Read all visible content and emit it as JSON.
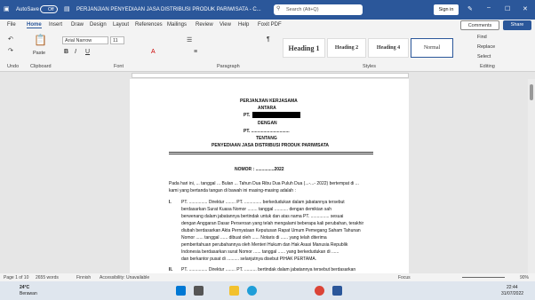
{
  "titlebar": {
    "autosave": "AutoSave",
    "autosave_state": "Off",
    "doc": "PERJANJIAN PENYEDIAAN JASA DISTRIBUSI PRODUK PARIWISATA - C... ",
    "search": "Search (Alt+Q)",
    "signin": "Sign in"
  },
  "tabs": [
    "File",
    "Home",
    "Insert",
    "Draw",
    "Design",
    "Layout",
    "References",
    "Mailings",
    "Review",
    "View",
    "Help",
    "Foxit PDF"
  ],
  "comments": "Comments",
  "share": "Share",
  "ribbon": {
    "font": "Arial Narrow",
    "size": "11",
    "groups": [
      "Undo",
      "Clipboard",
      "Font",
      "Paragraph",
      "Styles",
      "Editing"
    ],
    "paste": "Paste",
    "styles": [
      "Heading 1",
      "Heading 2",
      "Heading 4",
      "Normal"
    ],
    "find": "Find",
    "replace": "Replace",
    "select": "Select"
  },
  "doc": {
    "l1": "PERJANJIAN KERJASAMA",
    "l2": "ANTARA",
    "l3": "PT.",
    "l4": "DENGAN",
    "l5": "PT. ...............................",
    "l6": "TENTANG",
    "l7": "PENYEDIAAN JASA DISTRIBUSI PRODUK PARIWISATA",
    "l8": "NOMOR   :   ...............2022",
    "p1a": "Pada hari ini, ... tanggal ... Bulan ... Tahun Dua Ribu Dua Puluh Dua (...-...- 2022) bertempat di ...",
    "p1b": "kami yang bertanda tangan di bawah ini masing-masing adalah :",
    "i1": "I.",
    "i1a": "PT. ............... Direktur ........ PT. .............. berkedudukan dalam jabatannya tersebut",
    "i1b": "berdasarkan Surat Kuasa Nomor ........ tanggal ........... dengan demikian sah",
    "i1c": "berwenang dalam jabatannya bertindak untuk dan atas nama PT. ............... sesuai",
    "i1d": "dengan Anggaran Dasar Perseroan yang telah mengalami beberapa kali perubahan, terakhir",
    "i1e": "diubah berdasarkan Akta Pernyataan Keputusan Rapat Umum Pemegang Saham Tahunan",
    "i1f": "Nomor ...... tanggal ...... dibuat oleh ...... Notaris di ...... yang telah diterima",
    "i1g": "pemberitahuan perubahannya oleh Menteri Hukum dan Hak Asasi Manusia Republik",
    "i1h": "Indonesia berdasarkan surat Nomor ...... tanggal ...... yang berkedudukan di ......",
    "i1i": "dan berkantor pusat di .......... selanjutnya disebut PIHAK PERTAMA.",
    "i2": "II.",
    "i2a": "PT. ............... Direktur ........ PT. .......... bertindak dalam jabatannya tersebut berdasarkan"
  },
  "status": {
    "page": "Page 1 of 10",
    "words": "2655 words",
    "lang": "Finnish",
    "access": "Accessibility: Unavailable",
    "focus": "Focus",
    "zoom": "90%"
  },
  "taskbar": {
    "temp": "24°C",
    "weather": "Berawan",
    "time": "22:44",
    "date": "31/07/2022"
  }
}
